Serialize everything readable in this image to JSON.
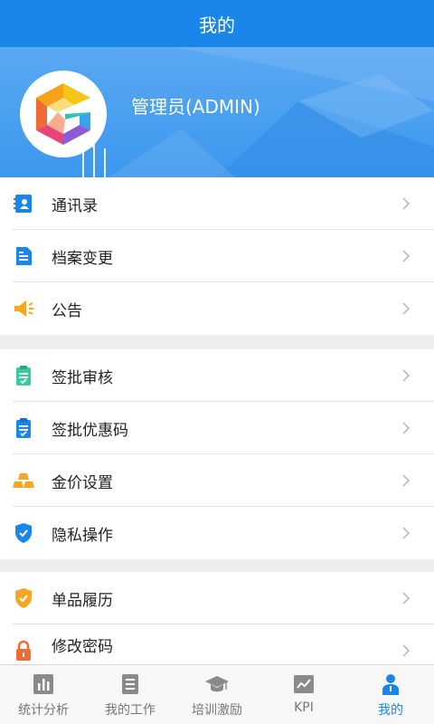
{
  "header": {
    "title": "我的"
  },
  "profile": {
    "name": "管理员(ADMIN)",
    "logo_letter": "G"
  },
  "menu_groups": [
    {
      "items": [
        {
          "label": "通讯录",
          "icon": "contacts-icon",
          "color": "#1a86ea"
        },
        {
          "label": "档案变更",
          "icon": "document-icon",
          "color": "#1a86ea"
        },
        {
          "label": "公告",
          "icon": "megaphone-icon",
          "color": "#f5a623"
        }
      ]
    },
    {
      "items": [
        {
          "label": "签批审核",
          "icon": "clipboard-icon",
          "color": "#3cc8a0"
        },
        {
          "label": "签批优惠码",
          "icon": "clipboard-icon",
          "color": "#1a86ea"
        },
        {
          "label": "金价设置",
          "icon": "gold-bars-icon",
          "color": "#f5a623"
        },
        {
          "label": "隐私操作",
          "icon": "shield-check-icon",
          "color": "#1a86ea"
        }
      ]
    },
    {
      "items": [
        {
          "label": "单品履历",
          "icon": "shield-check-icon",
          "color": "#f5a623"
        },
        {
          "label": "修改密码",
          "icon": "lock-icon",
          "color": "#f06a35"
        }
      ]
    }
  ],
  "tabbar": {
    "tabs": [
      {
        "label": "统计分析",
        "icon": "bar-chart-icon",
        "active": false
      },
      {
        "label": "我的工作",
        "icon": "list-icon",
        "active": false
      },
      {
        "label": "培训激励",
        "icon": "graduation-cap-icon",
        "active": false
      },
      {
        "label": "KPI",
        "icon": "line-chart-icon",
        "active": false
      },
      {
        "label": "我的",
        "icon": "person-icon",
        "active": true
      }
    ]
  },
  "colors": {
    "primary": "#1a86ea",
    "inactive": "#777777",
    "background": "#eeeeee"
  }
}
